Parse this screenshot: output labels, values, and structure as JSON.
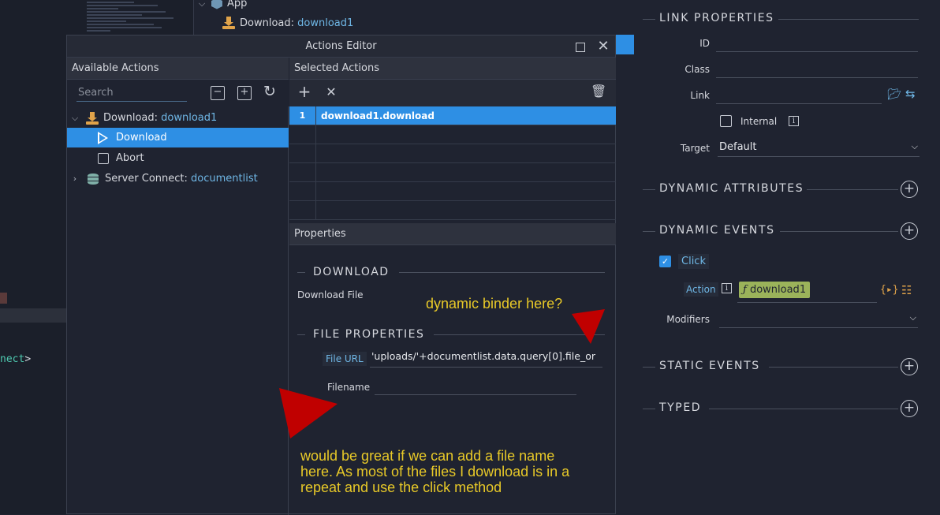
{
  "app_tree": {
    "app_label": "App",
    "download_prefix": "Download: ",
    "download_name": "download1"
  },
  "background_code": {
    "tail_colored": "nect",
    "tail_bracket": ">"
  },
  "dialog": {
    "title": "Actions Editor",
    "available_actions": {
      "header": "Available Actions",
      "search_placeholder": "Search",
      "tree": {
        "download_group_prefix": "Download: ",
        "download_group_name": "download1",
        "item_download": "Download",
        "item_abort": "Abort",
        "server_connect_prefix": "Server Connect: ",
        "server_connect_name": "documentlist"
      }
    },
    "selected_actions": {
      "header": "Selected Actions",
      "rows": [
        {
          "num": "1",
          "value": "download1.download"
        }
      ]
    },
    "properties": {
      "header": "Properties",
      "section_download": "DOWNLOAD",
      "download_desc": "Download File",
      "section_file": "FILE PROPERTIES",
      "file_url_label": "File URL",
      "file_url_value": "'uploads/'+documentlist.data.query[0].file_or",
      "filename_label": "Filename",
      "filename_value": ""
    }
  },
  "annotations": {
    "binder": "dynamic binder here?",
    "note_line1": "would be great if we can add a file name",
    "note_line2": "here. As most of the files I download is in a",
    "note_line3": "repeat and use the click method",
    "arrow_color": "#c00000"
  },
  "right_panel": {
    "link_properties": "LINK PROPERTIES",
    "id_label": "ID",
    "class_label": "Class",
    "link_label": "Link",
    "internal_label": "Internal",
    "target_label": "Target",
    "target_value": "Default",
    "dynamic_attributes": "DYNAMIC ATTRIBUTES",
    "dynamic_events": "DYNAMIC EVENTS",
    "click_label": "Click",
    "action_label": "Action",
    "action_value": "download1",
    "modifiers_label": "Modifiers",
    "static_events": "STATIC EVENTS",
    "typed": "TYPED"
  },
  "colors": {
    "accent_blue": "#2e8fe4",
    "link_blue": "#6fb7e6",
    "annotation_yellow": "#e8c928",
    "action_tag_bg": "#9bb35a"
  }
}
